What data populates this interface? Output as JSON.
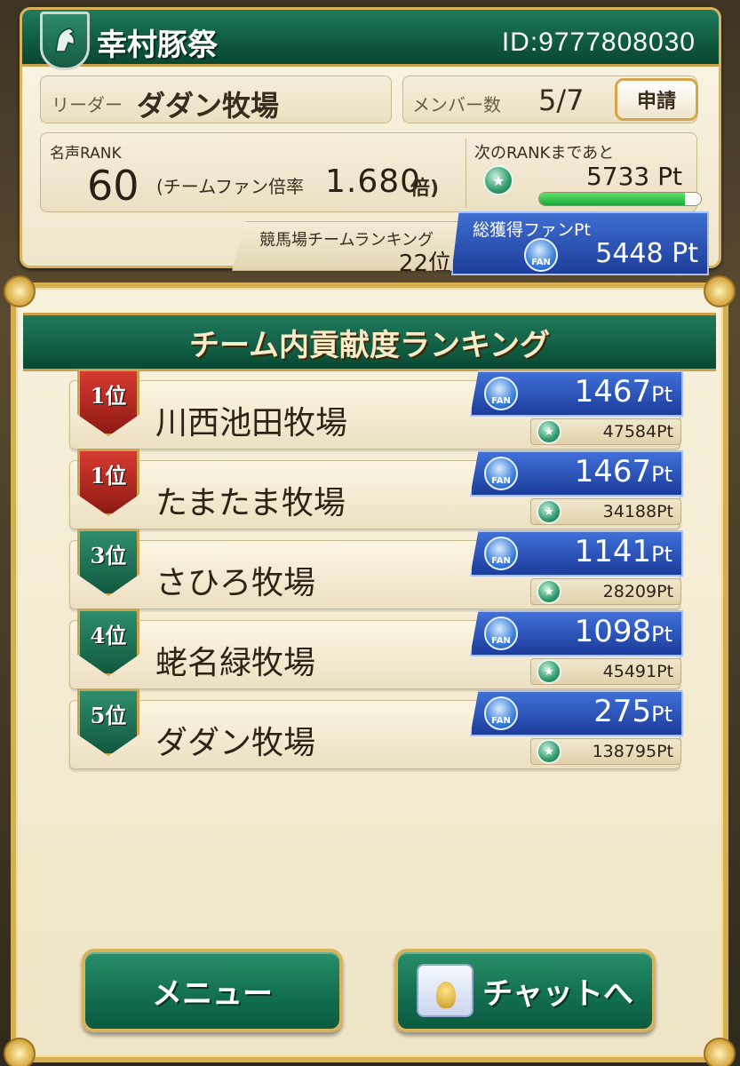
{
  "team": {
    "name": "幸村豚祭",
    "id_text": "ID:9777808030",
    "leader_label": "リーダー",
    "leader_name": "ダダン牧場",
    "member_label": "メンバー数",
    "member_count": "5/7",
    "apply_label": "申請",
    "fame_label": "名声RANK",
    "fame_value": "60",
    "multiplier_label": "(チームファン倍率",
    "multiplier_value": "1.680",
    "multiplier_unit": "倍)",
    "next_rank_label": "次のRANKまであと",
    "next_rank_value": "5733 Pt",
    "next_rank_progress": 0.9,
    "course_rank_label": "競馬場チームランキング",
    "course_rank_value": "22位",
    "total_fan_label": "総獲得ファンPt",
    "total_fan_value": "5448 Pt",
    "fan_icon_text": "FAN"
  },
  "ranking": {
    "title": "チーム内貢献度ランキング",
    "rows": [
      {
        "rank": "1位",
        "badge": "red",
        "name": "川西池田牧場",
        "fan_pt": "1467",
        "total": "47584Pt"
      },
      {
        "rank": "1位",
        "badge": "red",
        "name": "たまたま牧場",
        "fan_pt": "1467",
        "total": "34188Pt"
      },
      {
        "rank": "3位",
        "badge": "green",
        "name": "さひろ牧場",
        "fan_pt": "1141",
        "total": "28209Pt"
      },
      {
        "rank": "4位",
        "badge": "green",
        "name": "蛯名緑牧場",
        "fan_pt": "1098",
        "total": "45491Pt"
      },
      {
        "rank": "5位",
        "badge": "green",
        "name": "ダダン牧場",
        "fan_pt": "275",
        "total": "138795Pt"
      }
    ],
    "pt_unit": "Pt"
  },
  "buttons": {
    "menu": "メニュー",
    "chat": "チャットへ"
  },
  "icons": {
    "team_emblem": "horse-head-icon",
    "medal": "medal-icon",
    "fan": "fan-icon",
    "chat": "chat-key-icon"
  }
}
